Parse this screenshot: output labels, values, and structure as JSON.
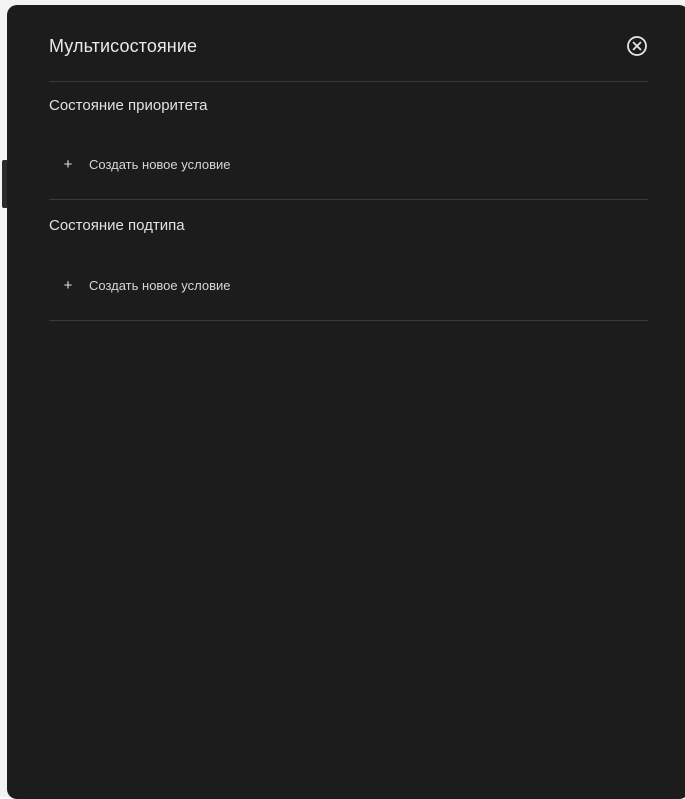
{
  "dialog": {
    "title": "Мультисостояние",
    "close_icon": "close-circle-icon"
  },
  "sections": [
    {
      "title": "Состояние приоритета",
      "add_label": "Создать новое условие",
      "add_icon": "plus-icon"
    },
    {
      "title": "Состояние подтипа",
      "add_label": "Создать новое условие",
      "add_icon": "plus-icon"
    }
  ],
  "colors": {
    "panel_bg": "#1c1c1c",
    "text": "#e8e8e8",
    "divider": "#3a3a3a"
  }
}
